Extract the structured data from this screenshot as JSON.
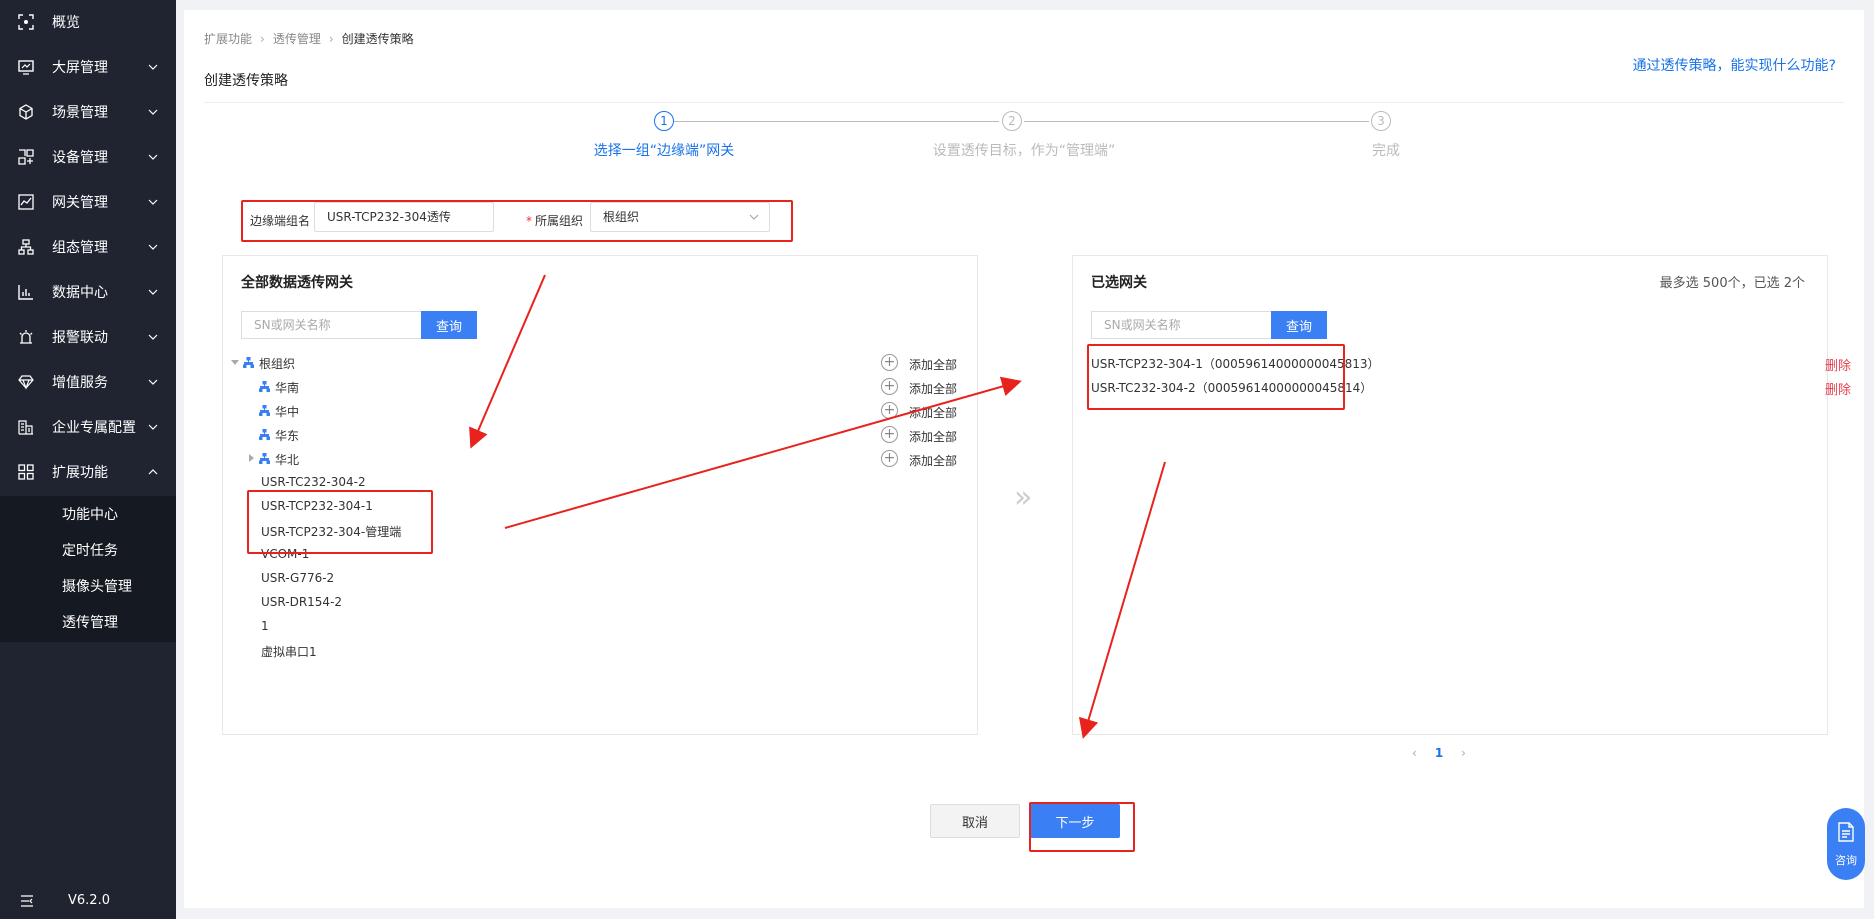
{
  "sidebar": {
    "items": [
      {
        "label": "概览",
        "icon": "scan-icon"
      },
      {
        "label": "大屏管理",
        "icon": "monitor-icon"
      },
      {
        "label": "场景管理",
        "icon": "cube-icon"
      },
      {
        "label": "设备管理",
        "icon": "device-grid-icon"
      },
      {
        "label": "网关管理",
        "icon": "chart-line-icon"
      },
      {
        "label": "组态管理",
        "icon": "hierarchy-icon"
      },
      {
        "label": "数据中心",
        "icon": "bar-chart-icon"
      },
      {
        "label": "报警联动",
        "icon": "alarm-icon"
      },
      {
        "label": "增值服务",
        "icon": "diamond-icon"
      },
      {
        "label": "企业专属配置",
        "icon": "building-icon"
      },
      {
        "label": "扩展功能",
        "icon": "apps-icon"
      }
    ],
    "sub_items": [
      "功能中心",
      "定时任务",
      "摄像头管理",
      "透传管理"
    ],
    "version": "V6.2.0"
  },
  "breadcrumb": [
    "扩展功能",
    "透传管理",
    "创建透传策略"
  ],
  "page_title": "创建透传策略",
  "help_link": "通过透传策略，能实现什么功能?",
  "steps": [
    {
      "num": "1",
      "label": "选择一组“边缘端”网关"
    },
    {
      "num": "2",
      "label": "设置透传目标，作为“管理端”"
    },
    {
      "num": "3",
      "label": "完成"
    }
  ],
  "form": {
    "group_name_label": "边缘端组名",
    "group_name_value": "USR-TCP232-304透传",
    "org_label": "所属组织",
    "org_value": "根组织"
  },
  "left_panel": {
    "title": "全部数据透传网关",
    "search_placeholder": "SN或网关名称",
    "search_button": "查询",
    "add_all_label": "添加全部",
    "tree": [
      {
        "label": "根组织"
      },
      {
        "label": "华南"
      },
      {
        "label": "华中"
      },
      {
        "label": "华东"
      },
      {
        "label": "华北"
      }
    ],
    "gateways": [
      "USR-TC232-304-2",
      "USR-TCP232-304-1",
      "USR-TCP232-304-管理端",
      "VCOM-1",
      "USR-G776-2",
      "USR-DR154-2",
      "1",
      "虚拟串口1"
    ]
  },
  "right_panel": {
    "title": "已选网关",
    "meta": "最多选 500个，已选 2个",
    "search_placeholder": "SN或网关名称",
    "search_button": "查询",
    "delete_label": "删除",
    "selected": [
      "USR-TCP232-304-1（00059614000000045813）",
      "USR-TC232-304-2（00059614000000045814）"
    ]
  },
  "pager": {
    "prev": "‹",
    "page": "1",
    "next": "›"
  },
  "buttons": {
    "cancel": "取消",
    "next": "下一步"
  },
  "consult_label": "咨询",
  "colors": {
    "accent": "#3b7ff5",
    "sidebar": "#1f2430",
    "danger": "#e8404f",
    "annotation": "#e8221c"
  }
}
